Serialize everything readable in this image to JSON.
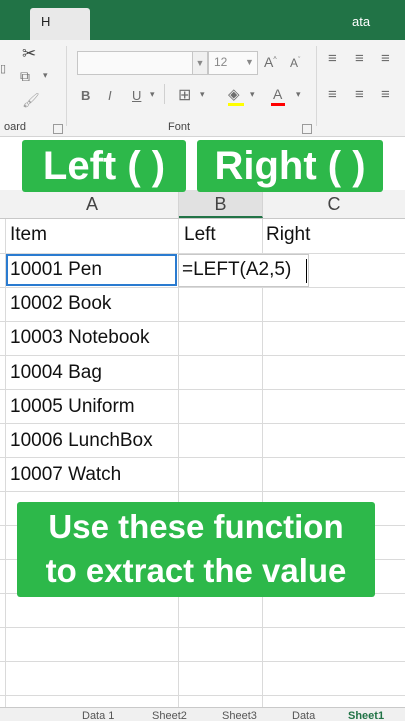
{
  "ribbon": {
    "home_tab": "H",
    "data_tab": "ata",
    "font_size": "12",
    "bold": "B",
    "italic": "I",
    "underline": "U",
    "font_group_label": "Font",
    "clipboard_label": "oard"
  },
  "columns": [
    "A",
    "B",
    "C"
  ],
  "headers": {
    "item": "Item",
    "left": "Left",
    "right": "Right"
  },
  "rows": [
    "10001 Pen",
    "10002 Book",
    "10003 Notebook",
    "10004 Bag",
    "10005 Uniform",
    "10006 LunchBox",
    "10007 Watch"
  ],
  "formula": "=LEFT(A2,5)",
  "banners": {
    "left": "Left ( )",
    "right": "Right ( )",
    "bottom_line1": "Use these function",
    "bottom_line2": "to extract the value"
  },
  "sheet_tabs": [
    "Data 1",
    "Sheet2",
    "Sheet3",
    "Data",
    "Sheet1"
  ],
  "colors": {
    "excel_green": "#217346",
    "banner_green": "#2db84a",
    "selection_blue": "#2a7bd0"
  }
}
